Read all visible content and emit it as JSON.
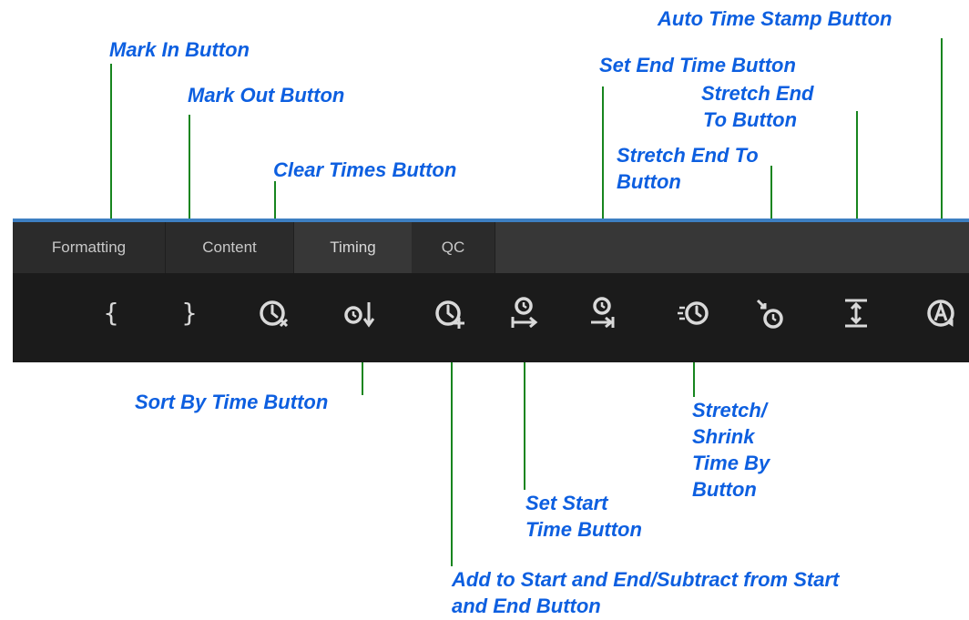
{
  "tabs": [
    {
      "label": "Formatting",
      "active": false
    },
    {
      "label": "Content",
      "active": false
    },
    {
      "label": "Timing",
      "active": true
    },
    {
      "label": "QC",
      "active": false
    }
  ],
  "toolbar": {
    "mark_in_glyph": "{",
    "mark_out_glyph": "}",
    "icons": [
      "mark-in-icon",
      "mark-out-icon",
      "clear-times-icon",
      "sort-by-time-icon",
      "add-subtract-time-icon",
      "set-start-time-icon",
      "set-end-time-icon",
      "stretch-shrink-time-icon",
      "stretch-end-to-icon",
      "stretch-end-to-vertical-icon",
      "auto-time-stamp-icon"
    ]
  },
  "callouts": {
    "mark_in": "Mark In Button",
    "mark_out": "Mark Out Button",
    "clear_times": "Clear Times Button",
    "sort_by_time": "Sort By Time Button",
    "add_subtract": [
      "Add to Start and End/Subtract from Start",
      "and End Button"
    ],
    "set_start": [
      "Set Start",
      "Time Button"
    ],
    "set_end": "Set End Time Button",
    "stretch_shrink": [
      "Stretch/",
      "Shrink",
      "Time By",
      "Button"
    ],
    "stretch_end_to": [
      "Stretch End To",
      "Button"
    ],
    "stretch_end_to_2": [
      "Stretch End",
      "To Button"
    ],
    "auto_time_stamp": "Auto Time Stamp Button"
  },
  "colors": {
    "callout_text": "#0d5fe0",
    "leader_line": "#17851f",
    "tab_accent": "#3d7fc2",
    "toolbar_bg": "#1b1b1b",
    "icon": "#d9d9d9"
  }
}
